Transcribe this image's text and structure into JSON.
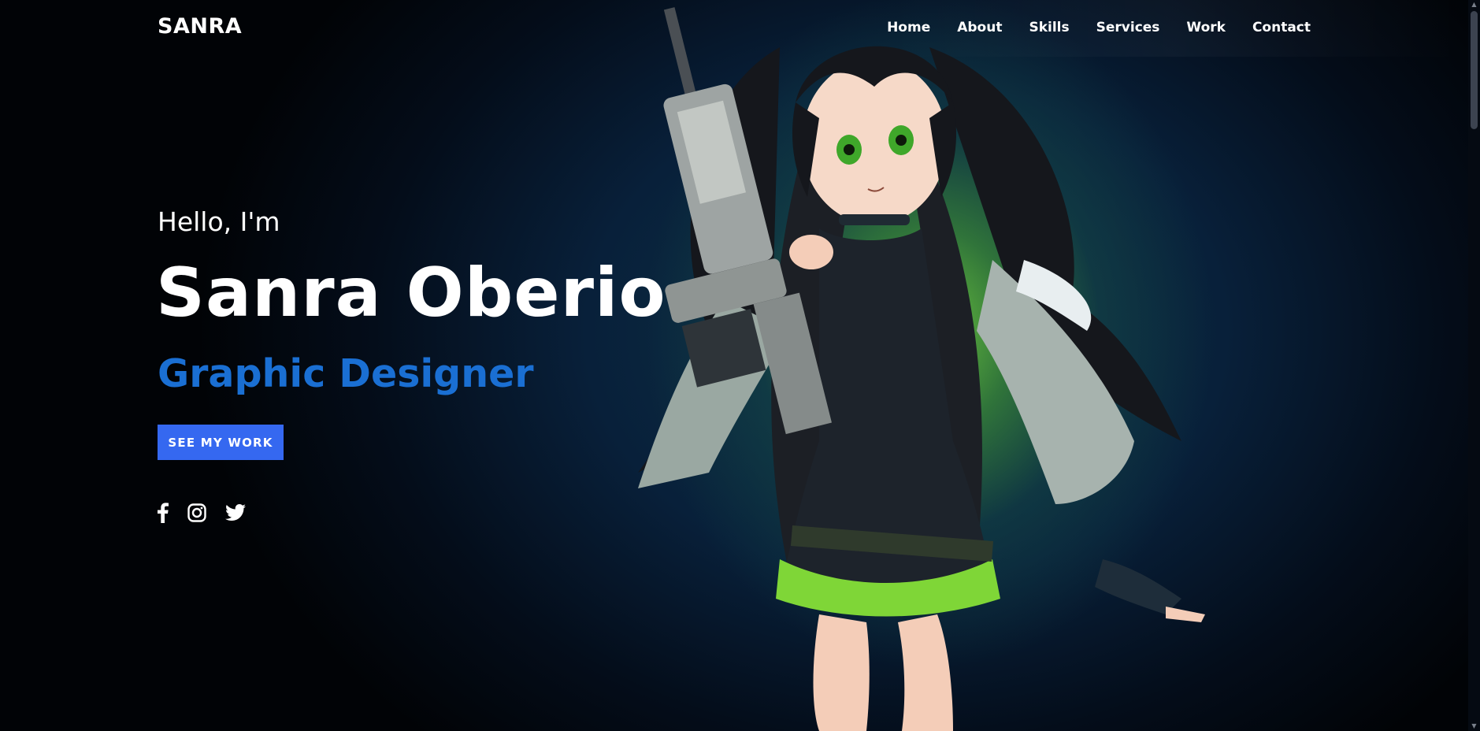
{
  "header": {
    "logo": "SANRA",
    "nav": [
      "Home",
      "About",
      "Skills",
      "Services",
      "Work",
      "Contact"
    ]
  },
  "hero": {
    "greeting": "Hello, I'm",
    "name": "Sanra Oberio",
    "role": "Graphic Designer",
    "cta_label": "SEE MY WORK"
  },
  "socials": [
    "facebook-icon",
    "instagram-icon",
    "twitter-icon"
  ],
  "colors": {
    "accent_blue": "#1a6fd3",
    "button_blue": "#3568f0",
    "glow_green": "#6ec83c",
    "background_dark": "#02060c"
  }
}
